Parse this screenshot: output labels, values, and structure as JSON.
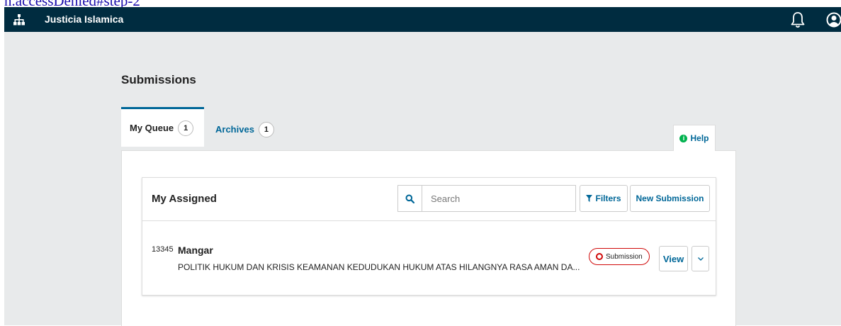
{
  "stray_link": "n.accessDenied#step-2",
  "header": {
    "site_title": "Justicia Islamica",
    "icons": {
      "site": "sitemap-icon",
      "notifications": "bell-icon",
      "user": "user-avatar-icon"
    }
  },
  "page": {
    "title": "Submissions"
  },
  "tabs": [
    {
      "label": "My Queue",
      "count": "1",
      "active": true
    },
    {
      "label": "Archives",
      "count": "1",
      "active": false
    }
  ],
  "help": {
    "label": "Help"
  },
  "list": {
    "title": "My Assigned",
    "search": {
      "placeholder": "Search",
      "value": ""
    },
    "filters_label": "Filters",
    "new_submission_label": "New Submission",
    "items": [
      {
        "id": "13345",
        "author": "Mangar",
        "title": "POLITIK HUKUM DAN KRISIS KEAMANAN KEDUDUKAN HUKUM ATAS HILANGNYA RASA AMAN DA...",
        "stage": "Submission",
        "view_label": "View"
      }
    ]
  },
  "colors": {
    "topbar": "#002c40",
    "accent": "#006798",
    "stage_border": "#d00a0a",
    "help_icon": "#00b24e",
    "page_bg": "#e8eaeb"
  }
}
